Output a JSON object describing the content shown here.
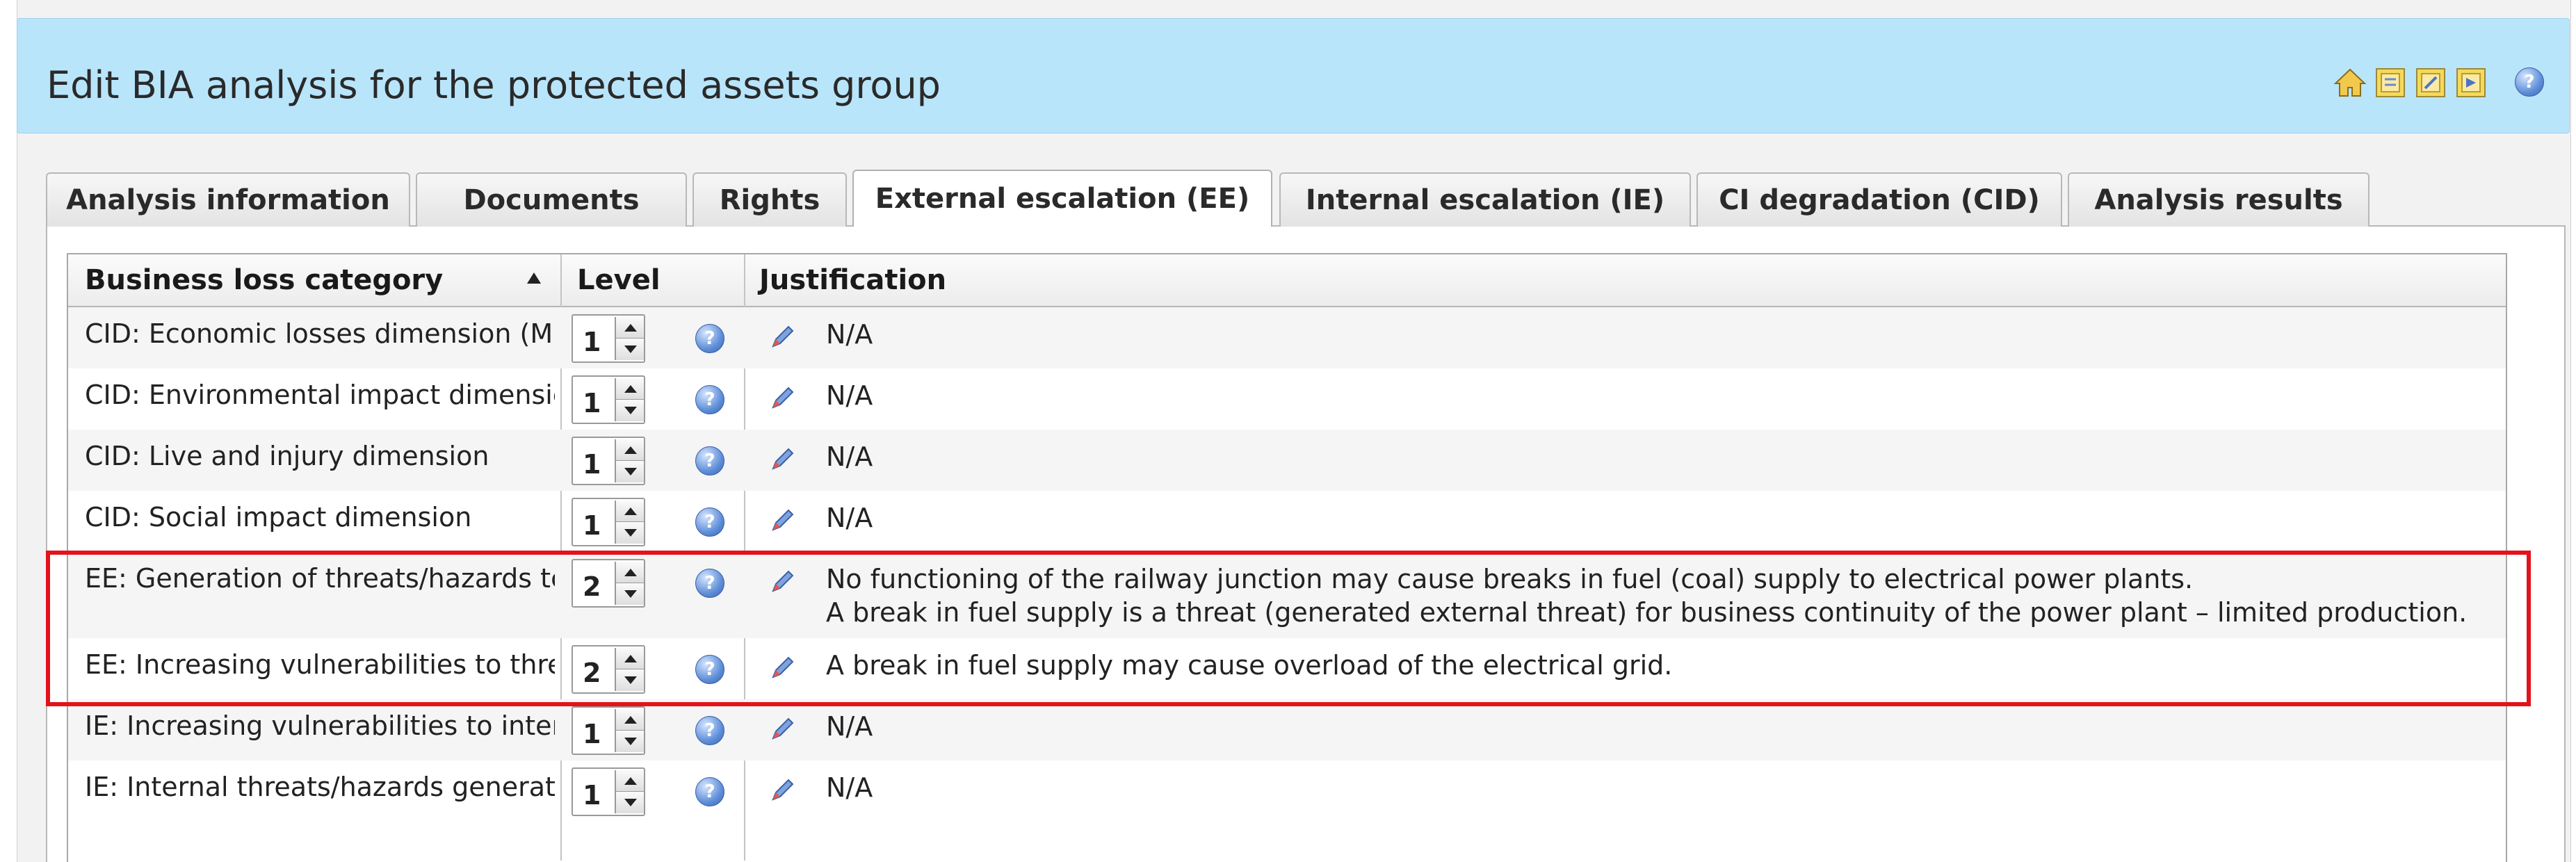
{
  "header": {
    "title": "Edit BIA analysis for the protected assets group",
    "icons": [
      "home-icon",
      "yellow-doc-icon",
      "yellow-doc-icon",
      "yellow-doc-icon",
      "help-icon"
    ]
  },
  "tabs": [
    {
      "label": "Analysis information",
      "active": false
    },
    {
      "label": "Documents",
      "active": false
    },
    {
      "label": "Rights",
      "active": false
    },
    {
      "label": "External escalation (EE)",
      "active": true
    },
    {
      "label": "Internal escalation (IE)",
      "active": false
    },
    {
      "label": "CI degradation (CID)",
      "active": false
    },
    {
      "label": "Analysis results",
      "active": false
    }
  ],
  "grid": {
    "columns": {
      "category": "Business loss category",
      "level": "Level",
      "justification": "Justification"
    },
    "sort": "ascending",
    "rows": [
      {
        "category": "CID: Economic losses dimension (Mi",
        "level": "1",
        "justification": [
          "N/A"
        ]
      },
      {
        "category": "CID: Environmental impact dimensic",
        "level": "1",
        "justification": [
          "N/A"
        ]
      },
      {
        "category": "CID: Live and injury dimension",
        "level": "1",
        "justification": [
          "N/A"
        ]
      },
      {
        "category": "CID: Social impact dimension",
        "level": "1",
        "justification": [
          "N/A"
        ]
      },
      {
        "category": "EE: Generation of threats/hazards tc",
        "level": "2",
        "justification": [
          "No functioning of the railway junction may cause breaks in fuel (coal) supply to electrical power plants.",
          "A break in fuel supply is a threat (generated external threat) for business continuity of the power plant – limited production."
        ]
      },
      {
        "category": "EE: Increasing vulnerabilities to thre",
        "level": "2",
        "justification": [
          "A break in fuel supply may cause overload of the electrical grid."
        ]
      },
      {
        "category": "IE: Increasing vulnerabilities to inter",
        "level": "1",
        "justification": [
          "N/A"
        ]
      },
      {
        "category": "IE: Internal threats/hazards generat",
        "level": "1",
        "justification": [
          "N/A"
        ]
      }
    ]
  },
  "highlight_color": "#e3121b"
}
